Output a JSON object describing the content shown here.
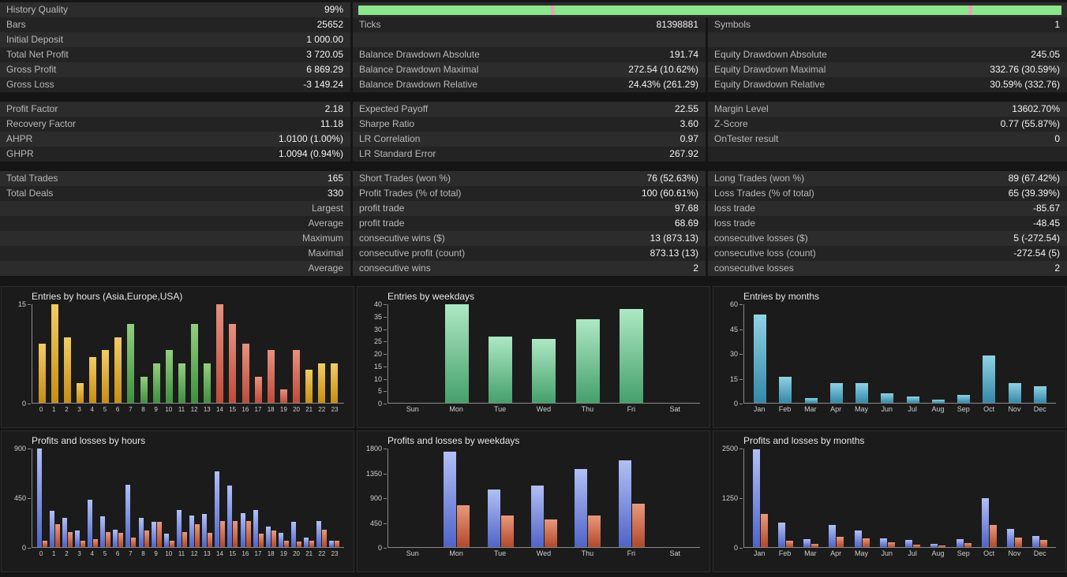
{
  "history_quality": {
    "label": "History Quality",
    "value": "99%",
    "bar_color": "#8ce68c",
    "gap_color": "#e8a0b8",
    "gaps_pct": [
      27.4,
      86.8
    ]
  },
  "stats_rows": [
    {
      "cells": [
        "Bars",
        "25652",
        "Ticks",
        "81398881",
        "Symbols",
        "1"
      ]
    },
    {
      "cells": [
        "Initial Deposit",
        "1 000.00",
        "",
        "",
        "",
        ""
      ]
    },
    {
      "cells": [
        "Total Net Profit",
        "3 720.05",
        "Balance Drawdown Absolute",
        "191.74",
        "Equity Drawdown Absolute",
        "245.05"
      ]
    },
    {
      "cells": [
        "Gross Profit",
        "6 869.29",
        "Balance Drawdown Maximal",
        "272.54 (10.62%)",
        "Equity Drawdown Maximal",
        "332.76 (30.59%)"
      ]
    },
    {
      "cells": [
        "Gross Loss",
        "-3 149.24",
        "Balance Drawdown Relative",
        "24.43% (261.29)",
        "Equity Drawdown Relative",
        "30.59% (332.76)"
      ]
    },
    {
      "spacer": true
    },
    {
      "cells": [
        "Profit Factor",
        "2.18",
        "Expected Payoff",
        "22.55",
        "Margin Level",
        "13602.70%"
      ]
    },
    {
      "cells": [
        "Recovery Factor",
        "11.18",
        "Sharpe Ratio",
        "3.60",
        "Z-Score",
        "0.77 (55.87%)"
      ]
    },
    {
      "cells": [
        "AHPR",
        "1.0100 (1.00%)",
        "LR Correlation",
        "0.97",
        "OnTester result",
        "0"
      ]
    },
    {
      "cells": [
        "GHPR",
        "1.0094 (0.94%)",
        "LR Standard Error",
        "267.92",
        "",
        ""
      ]
    },
    {
      "spacer": true
    },
    {
      "cells": [
        "Total Trades",
        "165",
        "Short Trades (won %)",
        "76 (52.63%)",
        "Long Trades (won %)",
        "89 (67.42%)"
      ]
    },
    {
      "cells": [
        "Total Deals",
        "330",
        "Profit Trades (% of total)",
        "100 (60.61%)",
        "Loss Trades (% of total)",
        "65 (39.39%)"
      ]
    },
    {
      "cells": [
        "",
        "Largest",
        "profit trade",
        "97.68",
        "loss trade",
        "-85.67"
      ],
      "v1_muted": true
    },
    {
      "cells": [
        "",
        "Average",
        "profit trade",
        "68.69",
        "loss trade",
        "-48.45"
      ],
      "v1_muted": true
    },
    {
      "cells": [
        "",
        "Maximum",
        "consecutive wins ($)",
        "13 (873.13)",
        "consecutive losses ($)",
        "5 (-272.54)"
      ],
      "v1_muted": true
    },
    {
      "cells": [
        "",
        "Maximal",
        "consecutive profit (count)",
        "873.13 (13)",
        "consecutive loss (count)",
        "-272.54 (5)"
      ],
      "v1_muted": true
    },
    {
      "cells": [
        "",
        "Average",
        "consecutive wins",
        "2",
        "consecutive losses",
        "2"
      ],
      "v1_muted": true
    }
  ],
  "chart_data": [
    {
      "type": "bar",
      "title": "Entries by hours (Asia,Europe,USA)",
      "categories": [
        "0",
        "1",
        "2",
        "3",
        "4",
        "5",
        "6",
        "7",
        "8",
        "9",
        "10",
        "11",
        "12",
        "13",
        "14",
        "15",
        "16",
        "17",
        "18",
        "19",
        "20",
        "21",
        "22",
        "23"
      ],
      "values": [
        9,
        15,
        10,
        3,
        7,
        8,
        10,
        12,
        4,
        6,
        8,
        6,
        12,
        6,
        15,
        12,
        9,
        4,
        8,
        2,
        8,
        5,
        6,
        6
      ],
      "sessions": [
        "asia",
        "asia",
        "asia",
        "asia",
        "asia",
        "asia",
        "asia",
        "europe",
        "europe",
        "europe",
        "europe",
        "europe",
        "europe",
        "europe",
        "usa",
        "usa",
        "usa",
        "usa",
        "usa",
        "usa",
        "usa",
        "asia",
        "asia",
        "asia"
      ],
      "palette": {
        "asia": [
          "#f2cc66",
          "#c78d12"
        ],
        "europe": [
          "#93cf7d",
          "#3f8f3f"
        ],
        "usa": [
          "#e69180",
          "#bf4b38"
        ]
      },
      "ylim": [
        0,
        15
      ],
      "yticks": [
        0,
        15
      ],
      "grid": false,
      "legend": false
    },
    {
      "type": "bar",
      "title": "Entries by weekdays",
      "categories": [
        "Sun",
        "Mon",
        "Tue",
        "Wed",
        "Thu",
        "Fri",
        "Sat"
      ],
      "values": [
        0,
        40,
        27,
        26,
        34,
        38,
        0
      ],
      "color": [
        "#aee8c4",
        "#45a06c"
      ],
      "ylim": [
        0,
        40
      ],
      "yticks": [
        0,
        5,
        10,
        15,
        20,
        25,
        30,
        35,
        40
      ],
      "grid": false,
      "legend": false
    },
    {
      "type": "bar",
      "title": "Entries by months",
      "categories": [
        "Jan",
        "Feb",
        "Mar",
        "Apr",
        "May",
        "Jun",
        "Jul",
        "Aug",
        "Sep",
        "Oct",
        "Nov",
        "Dec"
      ],
      "values": [
        54,
        16,
        3,
        12,
        12,
        6,
        4,
        2,
        5,
        29,
        12,
        10
      ],
      "color": [
        "#8fd2e4",
        "#3488a8"
      ],
      "ylim": [
        0,
        60
      ],
      "yticks": [
        0,
        15,
        30,
        45,
        60
      ],
      "grid": false,
      "legend": false
    },
    {
      "type": "bar",
      "title": "Profits and losses by hours",
      "categories": [
        "0",
        "1",
        "2",
        "3",
        "4",
        "5",
        "6",
        "7",
        "8",
        "9",
        "10",
        "11",
        "12",
        "13",
        "14",
        "15",
        "16",
        "17",
        "18",
        "19",
        "20",
        "21",
        "22",
        "23"
      ],
      "series": [
        {
          "name": "profit",
          "color": [
            "#b2c0f5",
            "#4f64c8"
          ],
          "values": [
            900,
            330,
            270,
            150,
            430,
            280,
            160,
            570,
            270,
            230,
            120,
            340,
            290,
            300,
            690,
            560,
            310,
            340,
            190,
            130,
            230,
            90,
            240,
            60
          ]
        },
        {
          "name": "loss",
          "color": [
            "#e8997c",
            "#b2492c"
          ],
          "values": [
            60,
            210,
            140,
            60,
            70,
            140,
            130,
            90,
            150,
            230,
            60,
            140,
            210,
            130,
            240,
            240,
            240,
            120,
            150,
            60,
            50,
            60,
            160,
            60
          ]
        }
      ],
      "ylim": [
        0,
        900
      ],
      "yticks": [
        0,
        450,
        900
      ],
      "grid": false,
      "legend": false
    },
    {
      "type": "bar",
      "title": "Profits and losses by weekdays",
      "categories": [
        "Sun",
        "Mon",
        "Tue",
        "Wed",
        "Thu",
        "Fri",
        "Sat"
      ],
      "series": [
        {
          "name": "profit",
          "color": [
            "#b2c0f5",
            "#4f64c8"
          ],
          "values": [
            0,
            1740,
            1050,
            1120,
            1420,
            1580,
            0
          ]
        },
        {
          "name": "loss",
          "color": [
            "#e8997c",
            "#b2492c"
          ],
          "values": [
            0,
            760,
            580,
            500,
            570,
            790,
            0
          ]
        }
      ],
      "ylim": [
        0,
        1800
      ],
      "yticks": [
        0,
        450,
        900,
        1350,
        1800
      ],
      "grid": false,
      "legend": false
    },
    {
      "type": "bar",
      "title": "Profits and losses by months",
      "categories": [
        "Jan",
        "Feb",
        "Mar",
        "Apr",
        "May",
        "Jun",
        "Jul",
        "Aug",
        "Sep",
        "Oct",
        "Nov",
        "Dec"
      ],
      "series": [
        {
          "name": "profit",
          "color": [
            "#b2c0f5",
            "#4f64c8"
          ],
          "values": [
            2480,
            620,
            200,
            560,
            430,
            220,
            190,
            90,
            210,
            1250,
            460,
            280
          ]
        },
        {
          "name": "loss",
          "color": [
            "#e8997c",
            "#b2492c"
          ],
          "values": [
            850,
            160,
            80,
            260,
            230,
            130,
            70,
            50,
            110,
            560,
            250,
            190
          ]
        }
      ],
      "ylim": [
        0,
        2500
      ],
      "yticks": [
        0,
        1250,
        2500
      ],
      "grid": false,
      "legend": false
    }
  ]
}
